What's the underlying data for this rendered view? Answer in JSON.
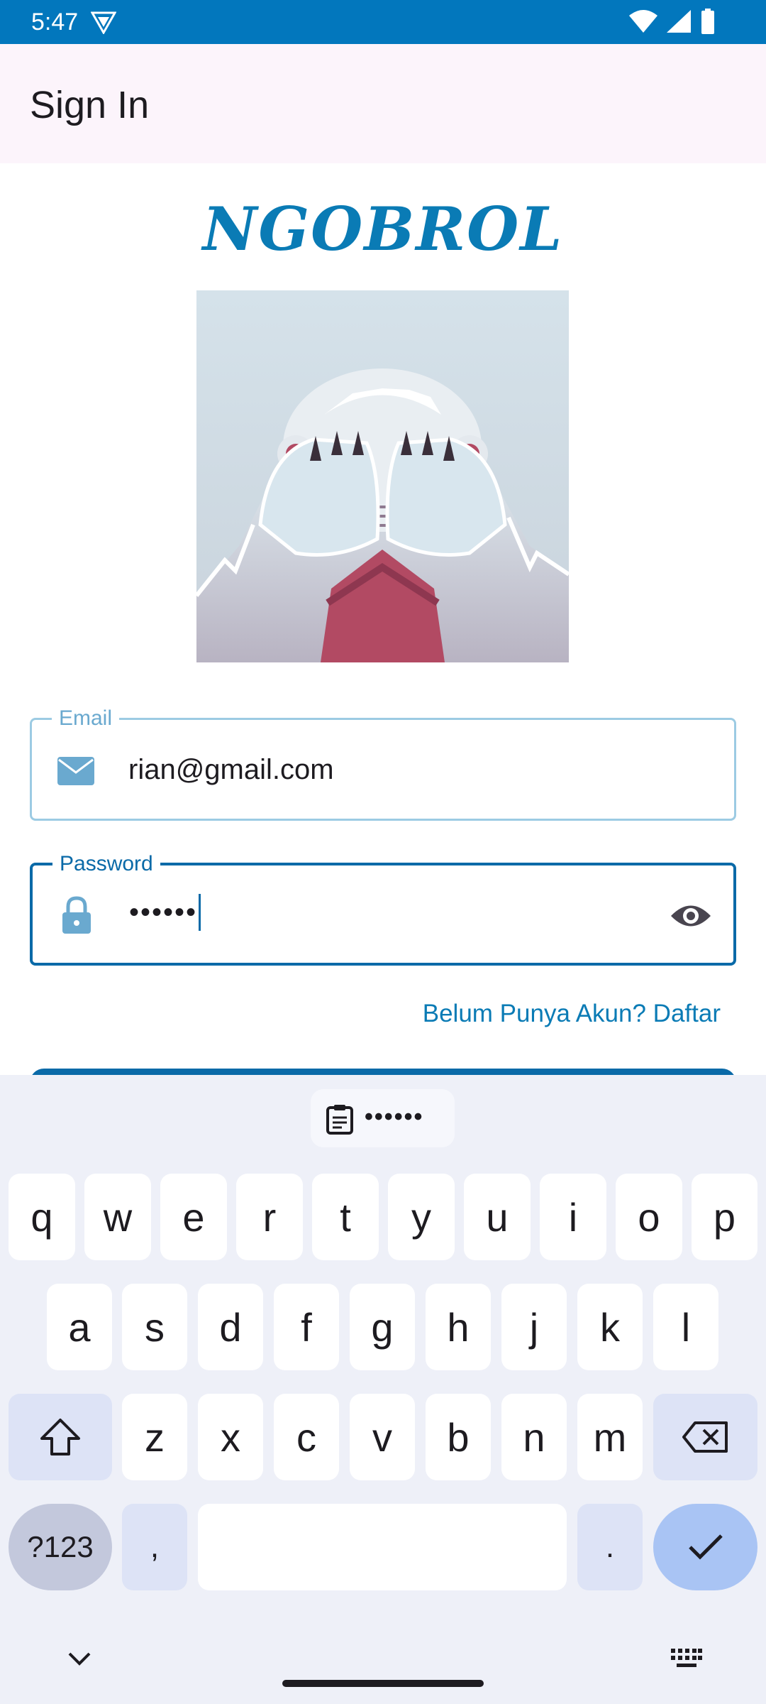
{
  "status_bar": {
    "time": "5:47"
  },
  "app_bar": {
    "title": "Sign In"
  },
  "logo": {
    "text": "NGOBROL"
  },
  "form": {
    "email": {
      "label": "Email",
      "value": "rian@gmail.com"
    },
    "password": {
      "label": "Password",
      "value": "••••••"
    },
    "signup_link": "Belum Punya Akun? Daftar"
  },
  "keyboard": {
    "clipboard_suggestion": "••••••",
    "row1": [
      "q",
      "w",
      "e",
      "r",
      "t",
      "y",
      "u",
      "i",
      "o",
      "p"
    ],
    "row2": [
      "a",
      "s",
      "d",
      "f",
      "g",
      "h",
      "j",
      "k",
      "l"
    ],
    "row3": [
      "z",
      "x",
      "c",
      "v",
      "b",
      "n",
      "m"
    ],
    "symbols_label": "?123",
    "comma": ",",
    "period": "."
  },
  "colors": {
    "primary": "#0a7bb5",
    "status_bar": "#0277bd",
    "app_bar": "#fcf4fb",
    "keyboard_bg": "#eef0f8"
  }
}
